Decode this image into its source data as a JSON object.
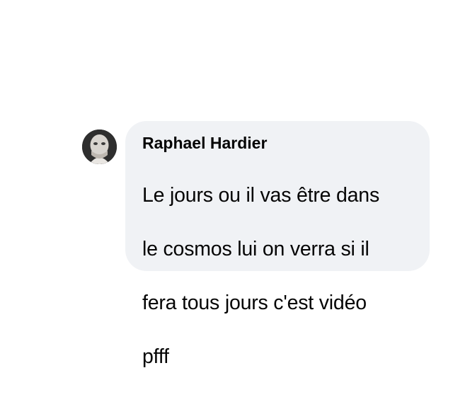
{
  "comment": {
    "author": "Raphael Hardier",
    "text_lines": [
      "Le jours ou il vas être dans",
      "le cosmos lui on verra si il",
      "fera tous jours c'est vidéo",
      "pfff"
    ],
    "avatar_icon": "user-avatar-photo"
  },
  "colors": {
    "bubble_background": "#f0f2f5",
    "text": "#050505",
    "page_background": "#ffffff"
  }
}
